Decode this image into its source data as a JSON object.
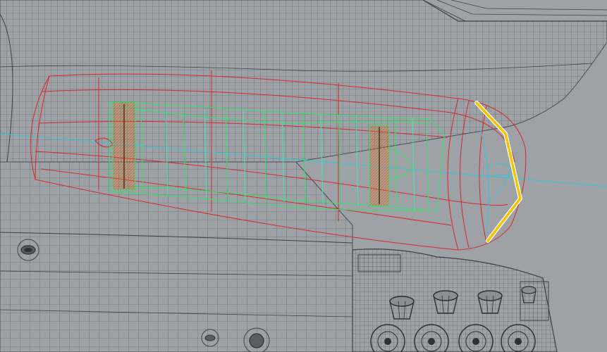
{
  "viewport": {
    "background": "#9ea1a6"
  },
  "colors": {
    "mesh": "#4a4d52",
    "mesh_fine": "#6d7075",
    "nacelle_outline": "#d62a2a",
    "engine_core": "#2ee36a",
    "engine_core_alt": "#47e6b0",
    "axis_line": "#30c8d8",
    "selected_edge": "#f5c400",
    "selected_edge_halo": "#ffffff",
    "hatch": "#e06b1f"
  },
  "icons": {
    "bolt_hole": "bolt-hole-icon",
    "cup_socket": "cup-socket-icon",
    "rotor_disk": "rotor-disk-icon"
  }
}
